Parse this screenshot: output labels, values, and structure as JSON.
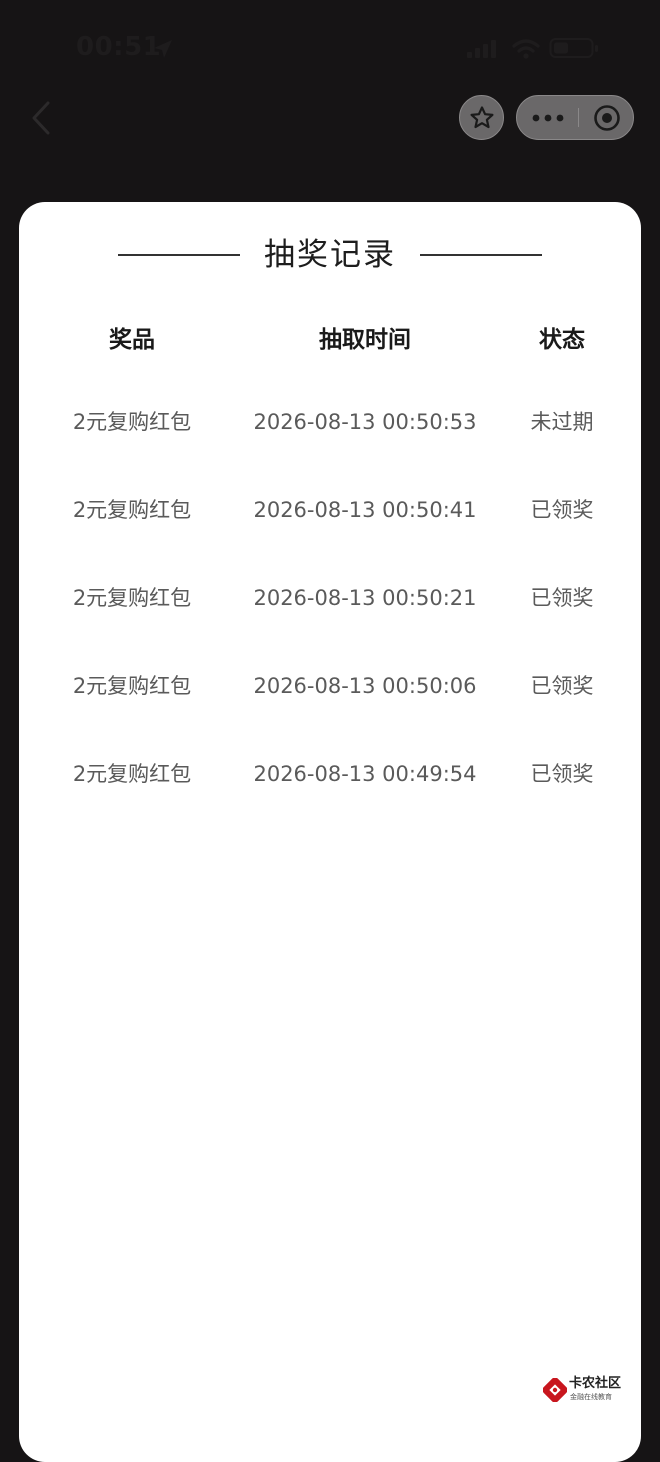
{
  "status_bar": {
    "time": "00:51"
  },
  "dialog": {
    "title": "抽奖记录",
    "columns": {
      "prize": "奖品",
      "time": "抽取时间",
      "status": "状态"
    },
    "rows": [
      {
        "prize": "2元复购红包",
        "time": "2026-08-13 00:50:53",
        "status": "未过期"
      },
      {
        "prize": "2元复购红包",
        "time": "2026-08-13 00:50:41",
        "status": "已领奖"
      },
      {
        "prize": "2元复购红包",
        "time": "2026-08-13 00:50:21",
        "status": "已领奖"
      },
      {
        "prize": "2元复购红包",
        "time": "2026-08-13 00:50:06",
        "status": "已领奖"
      },
      {
        "prize": "2元复购红包",
        "time": "2026-08-13 00:49:54",
        "status": "已领奖"
      }
    ]
  },
  "watermark": {
    "title": "卡农社区",
    "subtitle": "金融在线教育"
  },
  "colors": {
    "background": "#161415",
    "card": "#ffffff",
    "capsule": "#6a6869",
    "watermark_red": "#c8161e"
  }
}
